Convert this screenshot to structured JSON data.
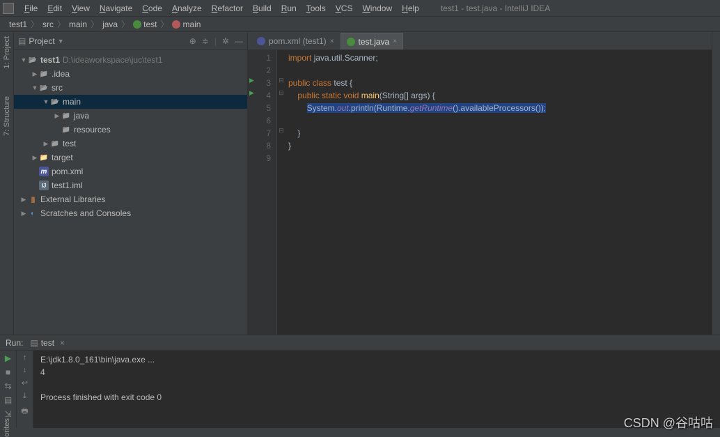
{
  "title": "test1 - test.java - IntelliJ IDEA",
  "menu": [
    "File",
    "Edit",
    "View",
    "Navigate",
    "Code",
    "Analyze",
    "Refactor",
    "Build",
    "Run",
    "Tools",
    "VCS",
    "Window",
    "Help"
  ],
  "breadcrumbs": [
    {
      "label": "test1"
    },
    {
      "label": "src"
    },
    {
      "label": "main"
    },
    {
      "label": "java"
    },
    {
      "label": "test",
      "icon": "class"
    },
    {
      "label": "main",
      "icon": "method"
    }
  ],
  "sidebar_tabs": [
    "1: Project",
    "7: Structure"
  ],
  "bottom_sidebar": "orites",
  "project_panel": {
    "title": "Project"
  },
  "tree": [
    {
      "depth": 0,
      "arrow": "▼",
      "icon": "folder-open",
      "label": "test1",
      "path": "D:\\ideaworkspace\\juc\\test1",
      "bold": true
    },
    {
      "depth": 1,
      "arrow": "▶",
      "icon": "folder",
      "label": ".idea"
    },
    {
      "depth": 1,
      "arrow": "▼",
      "icon": "folder-open folder-blue",
      "label": "src"
    },
    {
      "depth": 2,
      "arrow": "▼",
      "icon": "folder-open folder-blue",
      "label": "main",
      "selected": true
    },
    {
      "depth": 3,
      "arrow": "▶",
      "icon": "folder folder-blue",
      "label": "java"
    },
    {
      "depth": 3,
      "arrow": "",
      "icon": "folder",
      "label": "resources"
    },
    {
      "depth": 2,
      "arrow": "▶",
      "icon": "folder",
      "label": "test"
    },
    {
      "depth": 1,
      "arrow": "▶",
      "icon": "folder-orange",
      "label": "target"
    },
    {
      "depth": 1,
      "arrow": "",
      "icon": "m",
      "label": "pom.xml"
    },
    {
      "depth": 1,
      "arrow": "",
      "icon": "iml",
      "label": "test1.iml"
    },
    {
      "depth": 0,
      "arrow": "▶",
      "icon": "lib",
      "label": "External Libraries"
    },
    {
      "depth": 0,
      "arrow": "▶",
      "icon": "scratch",
      "label": "Scratches and Consoles"
    }
  ],
  "tabs": [
    {
      "label": "pom.xml (test1)",
      "icon": "m",
      "active": false
    },
    {
      "label": "test.java",
      "icon": "c",
      "active": true
    }
  ],
  "code": {
    "lines": [
      {
        "n": 1,
        "html": "<span class='kw'>import</span> <span class='cls'>java.util.Scanner;</span>"
      },
      {
        "n": 2,
        "html": ""
      },
      {
        "n": 3,
        "html": "<span class='kw'>public class</span> <span class='cls'>test {</span>",
        "run": true,
        "fold": "⊟"
      },
      {
        "n": 4,
        "html": "    <span class='kw'>public static</span> <span class='kw'>void</span> <span class='method'>main</span><span class='cls'>(String[] args) {</span>",
        "run": true,
        "fold": "⊟"
      },
      {
        "n": 5,
        "html": "        <span class='highlight'><span class='cls'>System.</span><span class='field'>out</span><span class='cls'>.println(Runtime.</span><span class='field'>getRuntime</span><span class='cls'>().availableProcessors());</span></span>"
      },
      {
        "n": 6,
        "html": ""
      },
      {
        "n": 7,
        "html": "    <span class='cls'>}</span>",
        "fold": "⊟"
      },
      {
        "n": 8,
        "html": "<span class='cls'>}</span>"
      },
      {
        "n": 9,
        "html": ""
      }
    ]
  },
  "run": {
    "title": "Run:",
    "config": "test",
    "output": [
      "E:\\jdk1.8.0_161\\bin\\java.exe ...",
      "4",
      "",
      "Process finished with exit code 0"
    ]
  },
  "watermark": "CSDN @谷咕咕"
}
